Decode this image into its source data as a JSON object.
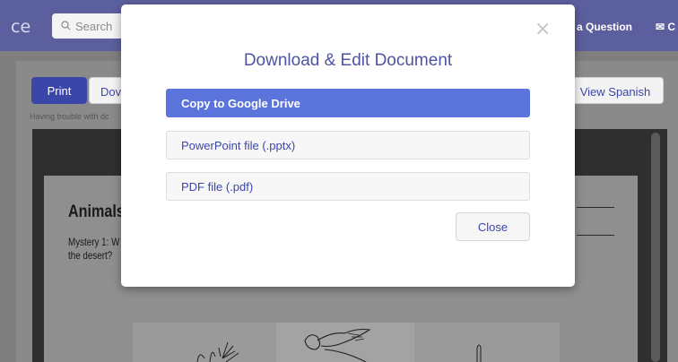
{
  "topbar": {
    "brand": "ce",
    "search_placeholder": "Search",
    "ask_label": "a Question",
    "contact_label": "C"
  },
  "toolbar": {
    "print_label": "Print",
    "download_label": "Dov",
    "view_spanish_label": "View Spanish",
    "trouble_text": "Having trouble with dc"
  },
  "document": {
    "title": "Animals",
    "line1": "Mystery 1: W",
    "line2": "the desert?"
  },
  "modal": {
    "title": "Download & Edit Document",
    "options": [
      {
        "label": "Copy to Google Drive"
      },
      {
        "label": "PowerPoint file (.pptx)"
      },
      {
        "label": "PDF file (.pdf)"
      }
    ],
    "close_label": "Close",
    "close_x": "×"
  },
  "colors": {
    "topbar": "#5c5f9e",
    "primary": "#5a74dc",
    "link": "#3b46a9"
  }
}
